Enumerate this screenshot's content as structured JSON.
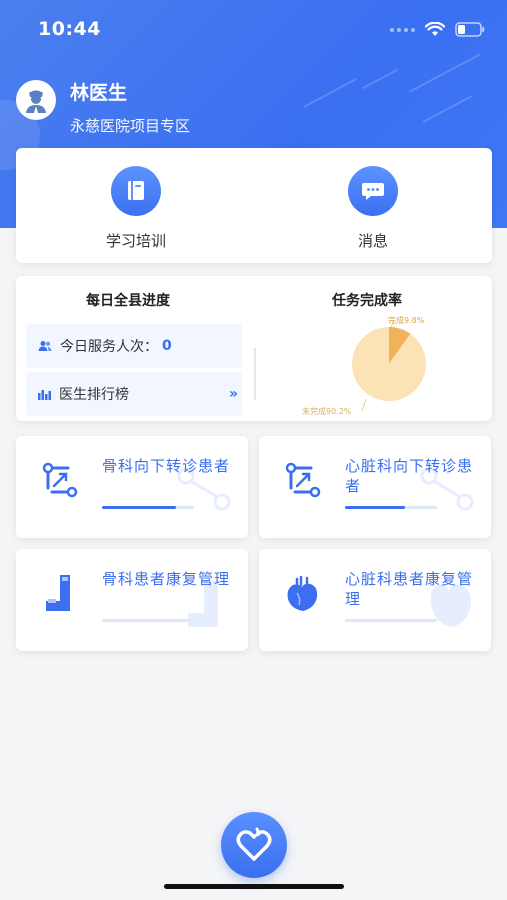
{
  "status_bar": {
    "time": "10:44"
  },
  "profile": {
    "name": "林医生",
    "hospital": "永慈医院项目专区"
  },
  "quick_actions": [
    {
      "label": "学习培训",
      "icon": "book-icon"
    },
    {
      "label": "消息",
      "icon": "message-icon"
    }
  ],
  "progress": {
    "daily_title": "每日全县进度",
    "service_label": "今日服务人次：",
    "service_value": "0",
    "ranking_label": "医生排行榜",
    "ranking_chevron": "»",
    "task_title": "任务完成率",
    "completed_label": "完成9.8%",
    "incomplete_label": "未完成90.2%"
  },
  "chart_data": {
    "type": "pie",
    "title": "任务完成率",
    "slices": [
      {
        "label": "完成",
        "value": 9.8,
        "color": "#f2b25a"
      },
      {
        "label": "未完成",
        "value": 90.2,
        "color": "#fbe3b6"
      }
    ]
  },
  "departments": [
    {
      "title": "骨科向下转诊患者",
      "icon": "referral-icon",
      "progress": 0.8
    },
    {
      "title": "心脏科向下转诊患者",
      "icon": "referral-icon",
      "progress": 0.65
    },
    {
      "title": "骨科患者康复管理",
      "icon": "bone-icon",
      "progress": 0
    },
    {
      "title": "心脏科患者康复管理",
      "icon": "heart-organ-icon",
      "progress": 0
    }
  ],
  "colors": {
    "primary": "#3b6ff0",
    "pie_complete": "#f2b25a",
    "pie_incomplete": "#fbe3b6"
  }
}
